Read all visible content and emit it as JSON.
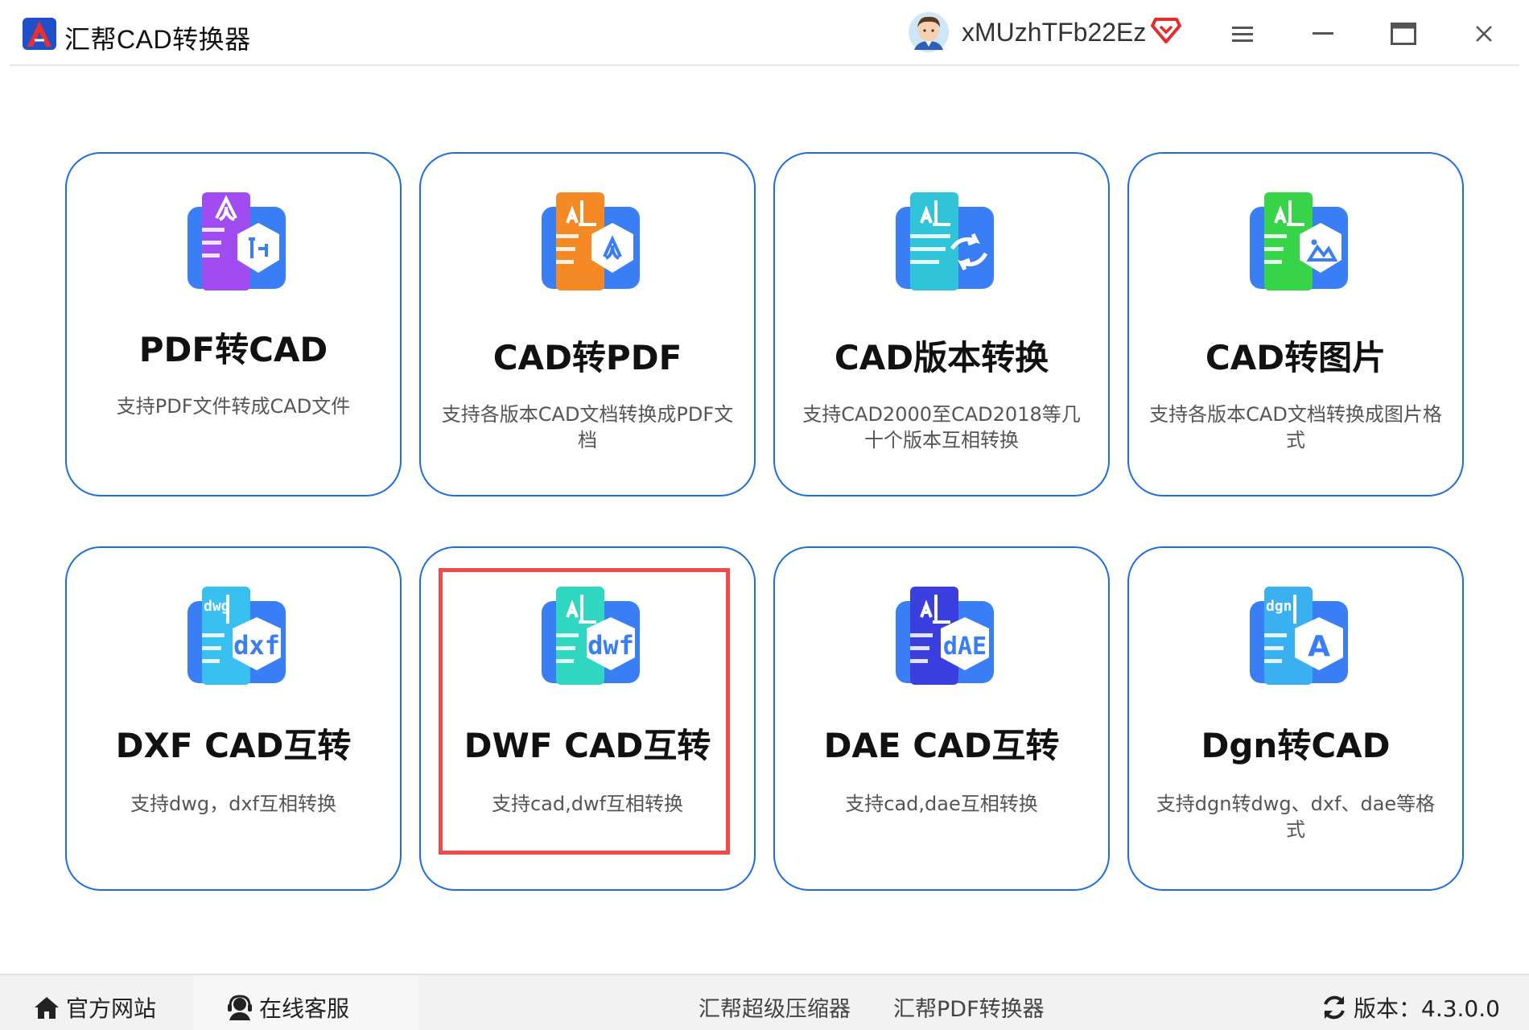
{
  "window": {
    "title": "汇帮CAD转换器",
    "user_name": "xMUzhTFb22Ez"
  },
  "cards": [
    {
      "title": "PDF转CAD",
      "desc": "支持PDF文件转成CAD文件",
      "icon": "pdf-to-cad-icon",
      "colors": [
        "#a14cf0",
        "#3a7ef5"
      ]
    },
    {
      "title": "CAD转PDF",
      "desc": "支持各版本CAD文档转换成PDF文档",
      "icon": "cad-to-pdf-icon",
      "colors": [
        "#f58a24",
        "#3a7ef5"
      ]
    },
    {
      "title": "CAD版本转换",
      "desc": "支持CAD2000至CAD2018等几十个版本互相转换",
      "icon": "cad-version-convert-icon",
      "colors": [
        "#30c4d9",
        "#3a7ef5"
      ]
    },
    {
      "title": "CAD转图片",
      "desc": "支持各版本CAD文档转换成图片格式",
      "icon": "cad-to-image-icon",
      "colors": [
        "#37d44a",
        "#3a7ef5"
      ]
    },
    {
      "title": "DXF CAD互转",
      "desc": "支持dwg，dxf互相转换",
      "icon": "dxf-cad-icon",
      "colors": [
        "#3ac0f0",
        "#3a7ef5"
      ],
      "badge_top": "dwg",
      "badge": "dxf"
    },
    {
      "title": "DWF CAD互转",
      "desc": "支持cad,dwf互相转换",
      "icon": "dwf-cad-icon",
      "colors": [
        "#2fd6c0",
        "#3a7ef5"
      ],
      "badge": "dwf"
    },
    {
      "title": "DAE CAD互转",
      "desc": "支持cad,dae互相转换",
      "icon": "dae-cad-icon",
      "colors": [
        "#3b3fe0",
        "#3a7ef5"
      ],
      "badge": "dAE"
    },
    {
      "title": "Dgn转CAD",
      "desc": "支持dgn转dwg、dxf、dae等格式",
      "icon": "dgn-to-cad-icon",
      "colors": [
        "#3ab0f0",
        "#3a7ef5"
      ],
      "badge_top": "dgn",
      "badge": "A"
    }
  ],
  "footer": {
    "website": "官方网站",
    "support": "在线客服",
    "compressor": "汇帮超级压缩器",
    "pdf_converter": "汇帮PDF转换器",
    "version": "版本：4.3.0.0"
  },
  "colors": {
    "card_border": "#1c6de0",
    "highlight": "#ef4b4b",
    "footer_bg": "#f2f2f2"
  }
}
